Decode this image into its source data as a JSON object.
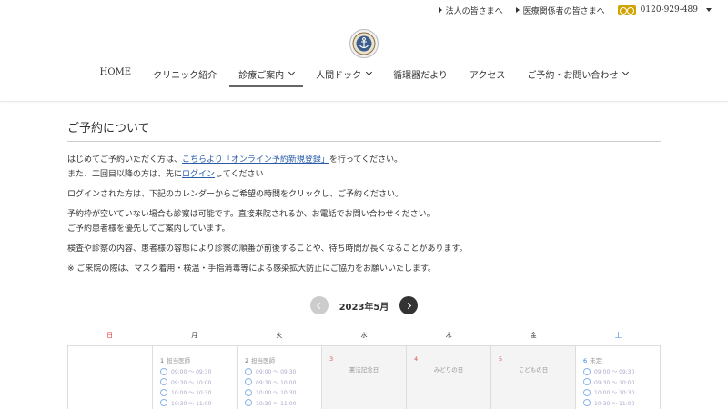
{
  "topbar": {
    "links": [
      "法人の皆さまへ",
      "医療関係者の皆さまへ"
    ],
    "phone": "0120-929-489"
  },
  "nav": {
    "items": [
      {
        "label": "HOME",
        "dropdown": false,
        "active": false
      },
      {
        "label": "クリニック紹介",
        "dropdown": false,
        "active": false
      },
      {
        "label": "診療ご案内",
        "dropdown": true,
        "active": true
      },
      {
        "label": "人間ドック",
        "dropdown": true,
        "active": false
      },
      {
        "label": "循環器だより",
        "dropdown": false,
        "active": false
      },
      {
        "label": "アクセス",
        "dropdown": false,
        "active": false
      },
      {
        "label": "ご予約・お問い合わせ",
        "dropdown": true,
        "active": false
      }
    ]
  },
  "page": {
    "title": "ご予約について",
    "p1_pre": "はじめてご予約いただく方は、",
    "p1_link": "こちらより「オンライン予約新規登録」",
    "p1_post": "を行ってください。",
    "p2_pre": "また、二回目以降の方は、先に",
    "p2_link": "ログイン",
    "p2_post": "してください",
    "p3": "ログインされた方は、下記のカレンダーからご希望の時間をクリックし、ご予約ください。",
    "p4a": "予約枠が空いていない場合も診察は可能です。直接来院されるか、お電話でお問い合わせください。",
    "p4b": "ご予約患者様を優先してご案内しています。",
    "p5": "検査や診察の内容、患者様の容態により診察の順番が前後することや、待ち時間が長くなることがあります。",
    "p6": "※ ご来院の際は、マスク着用・検温・手指消毒等による感染拡大防止にご協力をお願いいたします。"
  },
  "calendar": {
    "month_label": "2023年5月",
    "weekdays": [
      "日",
      "月",
      "火",
      "水",
      "木",
      "金",
      "土"
    ],
    "colors": {
      "sunday": "#dd3333",
      "saturday": "#2a7ad8"
    },
    "days": [
      {
        "num": "",
        "note": "",
        "holiday": "",
        "slots": []
      },
      {
        "num": "1",
        "note": "担当医師",
        "holiday": "",
        "slots": [
          "09:00 〜 09:30",
          "09:30 〜 10:00",
          "10:00 〜 10:30",
          "10:30 〜 11:00"
        ]
      },
      {
        "num": "2",
        "note": "担当医師",
        "holiday": "",
        "slots": [
          "09:00 〜 09:30",
          "09:30 〜 10:00",
          "10:00 〜 10:30",
          "10:30 〜 11:00"
        ]
      },
      {
        "num": "3",
        "note": "",
        "holiday": "憲法記念日",
        "slots": []
      },
      {
        "num": "4",
        "note": "",
        "holiday": "みどりの日",
        "slots": []
      },
      {
        "num": "5",
        "note": "",
        "holiday": "こどもの日",
        "slots": []
      },
      {
        "num": "6",
        "note": "未定",
        "holiday": "",
        "slots": [
          "09:00 〜 09:30",
          "09:30 〜 10:00",
          "10:00 〜 10:30",
          "10:30 〜 11:00"
        ]
      }
    ]
  }
}
